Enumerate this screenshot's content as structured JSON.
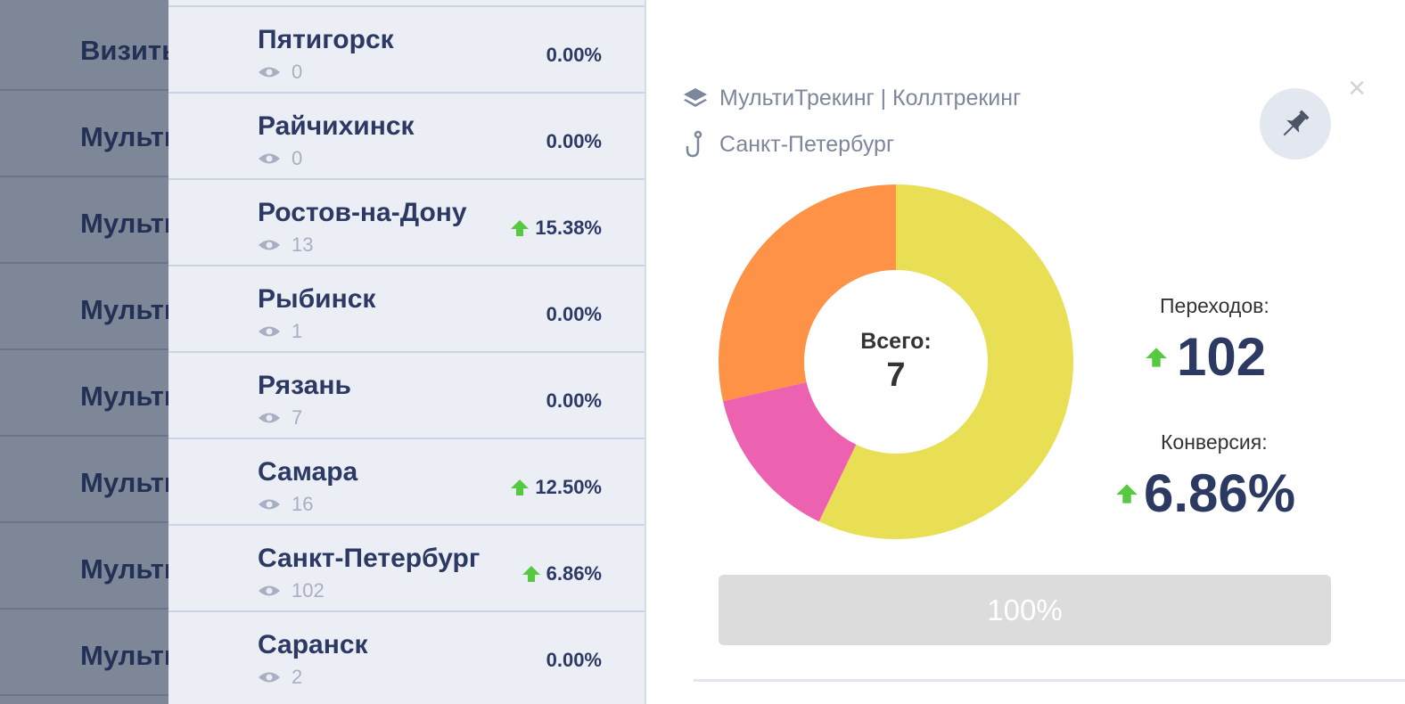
{
  "background_table": {
    "rows": [
      "Визиты",
      "Мульти",
      "Мульти",
      "Мульти",
      "Мульти",
      "Мульти",
      "Мульти",
      "Мульти"
    ]
  },
  "cities": [
    {
      "name": "Пятигорск",
      "views": "0",
      "pct": "0.00%",
      "trend": "none"
    },
    {
      "name": "Райчихинск",
      "views": "0",
      "pct": "0.00%",
      "trend": "none"
    },
    {
      "name": "Ростов-на-Дону",
      "views": "13",
      "pct": "15.38%",
      "trend": "up"
    },
    {
      "name": "Рыбинск",
      "views": "1",
      "pct": "0.00%",
      "trend": "none"
    },
    {
      "name": "Рязань",
      "views": "7",
      "pct": "0.00%",
      "trend": "none"
    },
    {
      "name": "Самара",
      "views": "16",
      "pct": "12.50%",
      "trend": "up"
    },
    {
      "name": "Санкт-Петербург",
      "views": "102",
      "pct": "6.86%",
      "trend": "up"
    },
    {
      "name": "Саранск",
      "views": "2",
      "pct": "0.00%",
      "trend": "none"
    }
  ],
  "detail": {
    "close_label": "×",
    "breadcrumb_product": "МультиТрекинг | Коллтрекинг",
    "breadcrumb_city": "Санкт-Петербург",
    "total_label": "Всего:",
    "total_value": "7",
    "transitions_label": "Переходов:",
    "transitions_value": "102",
    "conversion_label": "Конверсия:",
    "conversion_value": "6.86%",
    "progress_label": "100%",
    "progress_value": 1.0
  },
  "chart_data": {
    "type": "pie",
    "style": "donut",
    "total": 7,
    "slices": [
      {
        "value": 4,
        "color": "#e8df55"
      },
      {
        "value": 1,
        "color": "#ec62b0"
      },
      {
        "value": 2,
        "color": "#fe9246"
      }
    ]
  },
  "colors": {
    "accent_up": "#55c93f",
    "text_dark": "#2c3a63",
    "muted": "#a8afc2"
  }
}
